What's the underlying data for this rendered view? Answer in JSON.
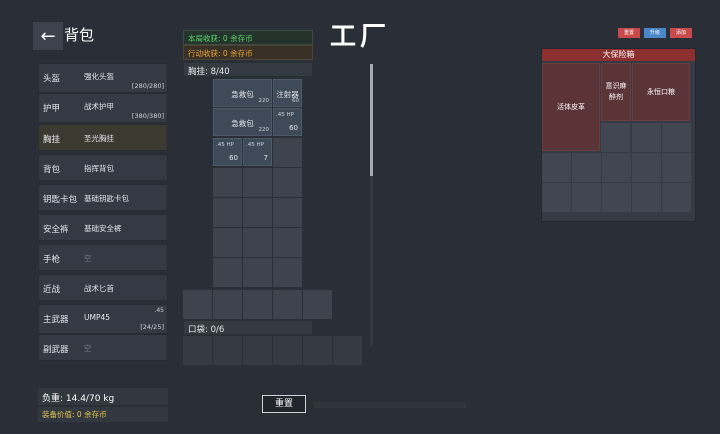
{
  "header": {
    "back_icon": "arrow-left-icon",
    "title": "背包",
    "map_title": "工厂"
  },
  "equipment": [
    {
      "label": "头盔",
      "item": "强化头盔",
      "durability": "[280/280]"
    },
    {
      "label": "护甲",
      "item": "战术护甲",
      "durability": "[380/380]"
    },
    {
      "label": "胸挂",
      "item": "圣光胸挂"
    },
    {
      "label": "背包",
      "item": "指挥背包"
    },
    {
      "label": "钥匙卡包",
      "item": "基础钥匙卡包"
    },
    {
      "label": "安全裤",
      "item": "基础安全裤"
    },
    {
      "label": "手枪",
      "item": "空"
    },
    {
      "label": "近战",
      "item": "战术匕首"
    },
    {
      "label": "主武器",
      "item": "UMP45",
      "extra": ".45",
      "durability": "[24/25]"
    },
    {
      "label": "副武器",
      "item": "空"
    }
  ],
  "stats": {
    "weight": "负重: 14.4/70 kg",
    "equipment_value": "装备价值: 0 余存币"
  },
  "banners": {
    "round_income": "本局收获: 0 余存币",
    "action_income": "行动收获: 0 余存币"
  },
  "rig": {
    "header": "胸挂: 8/40",
    "items": {
      "first_aid_1": {
        "name": "急救包",
        "count": "220"
      },
      "injector": {
        "name": "注射器",
        "count": "60"
      },
      "first_aid_2": {
        "name": "急救包",
        "count": "220"
      },
      "ammo_1": {
        "name": ".45 HP",
        "count": "60"
      },
      "ammo_2": {
        "name": ".45 HP",
        "count": "60"
      },
      "ammo_3": {
        "name": ".45 HP",
        "count": "7"
      }
    }
  },
  "pocket": {
    "header": "口袋: 0/6"
  },
  "buttons": {
    "reset": "重置",
    "top_1": "重置",
    "top_2": "升级",
    "top_3": "添加"
  },
  "safe": {
    "title": "大保险箱",
    "items": {
      "leather": "活体皮革",
      "anesthetic": "意识麻醉剂",
      "ration": "永恒口粮"
    }
  },
  "colors": {
    "background": "#2a2f37",
    "safe_title": "#8b2f2f",
    "income_green": "#58d66b",
    "income_orange": "#e8a43a",
    "value_gold": "#e8c34a",
    "btn_red": "#c94a4a",
    "btn_blue": "#4a87c9"
  }
}
